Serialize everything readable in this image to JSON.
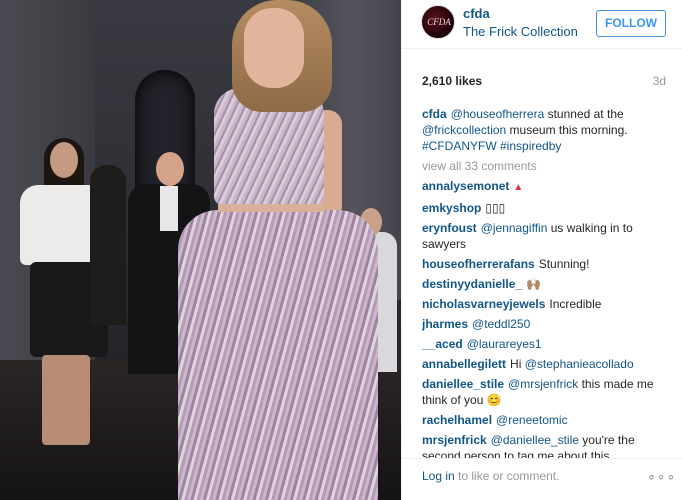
{
  "post": {
    "username": "cfda",
    "location": "The Frick Collection",
    "follow_label": "FOLLOW",
    "likes": "2,610 likes",
    "age": "3d",
    "avatar_text": "CFDA"
  },
  "caption": {
    "user": "cfda",
    "mention1": "@houseofherrera",
    "text1": " stunned at the ",
    "mention2": "@frickcollection",
    "text2": " museum this morning. ",
    "tags": "#CFDANYFW #inspiredby"
  },
  "view_all": "view all 33 comments",
  "comments": [
    {
      "user": "annalysemonet",
      "text": "▲",
      "mention": ""
    },
    {
      "user": "emkyshop",
      "text": "▯▯▯",
      "mention": ""
    },
    {
      "user": "erynfoust",
      "mention": "@jennagiffin",
      "text": " us walking in to sawyers"
    },
    {
      "user": "houseofherrerafans",
      "text": "Stunning!",
      "mention": ""
    },
    {
      "user": "destinyydanielle_",
      "text": "🙌🏽",
      "mention": ""
    },
    {
      "user": "nicholasvarneyjewels",
      "text": "Incredible",
      "mention": ""
    },
    {
      "user": "jharmes",
      "mention": "@teddl250",
      "text": ""
    },
    {
      "user": "__aced",
      "mention": "@laurareyes1",
      "text": ""
    },
    {
      "user": "annabellegilett",
      "text": "Hi ",
      "mention": "@stephanieacollado"
    },
    {
      "user": "daniellee_stile",
      "mention": "@mrsjenfrick",
      "text": " this made me think of you 😊"
    },
    {
      "user": "rachelhamel",
      "mention": "@reneetomic",
      "text": ""
    },
    {
      "user": "mrsjenfrick",
      "mention": "@daniellee_stile",
      "text": " you're the second person to tag me about this"
    }
  ],
  "footer": {
    "login_link": "Log in",
    "login_text": " to like or comment.",
    "more": "∘∘∘"
  }
}
